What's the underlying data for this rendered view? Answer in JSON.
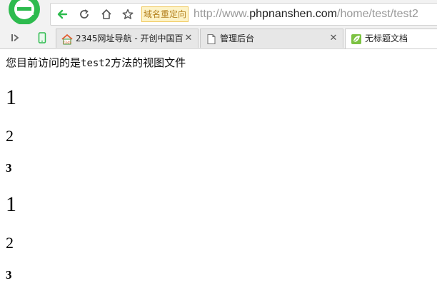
{
  "address_bar": {
    "badge": "域名重定向",
    "url_prefix": "http://www.",
    "url_host": "phpnanshen.com",
    "url_path": "/home/test/test2"
  },
  "tabs": [
    {
      "title": "2345网址导航 - 开创中国百",
      "favicon": "2345-house-icon",
      "active": false
    },
    {
      "title": "管理后台",
      "favicon": "page-icon",
      "active": false
    },
    {
      "title": "无标题文档",
      "favicon": "leaf-icon",
      "active": true
    }
  ],
  "page": {
    "intro_before": "您目前访问的是",
    "intro_code": "test2",
    "intro_after": "方法的视图文件",
    "headings": [
      {
        "level": "h1",
        "text": "1"
      },
      {
        "level": "h2",
        "text": "2"
      },
      {
        "level": "h3",
        "text": "3"
      },
      {
        "level": "h1",
        "text": "1"
      },
      {
        "level": "h2",
        "text": "2"
      },
      {
        "level": "h3",
        "text": "3"
      }
    ]
  },
  "colors": {
    "brand_green": "#2dbb4e",
    "badge_bg": "#fdf3c7",
    "badge_text": "#b58220"
  }
}
